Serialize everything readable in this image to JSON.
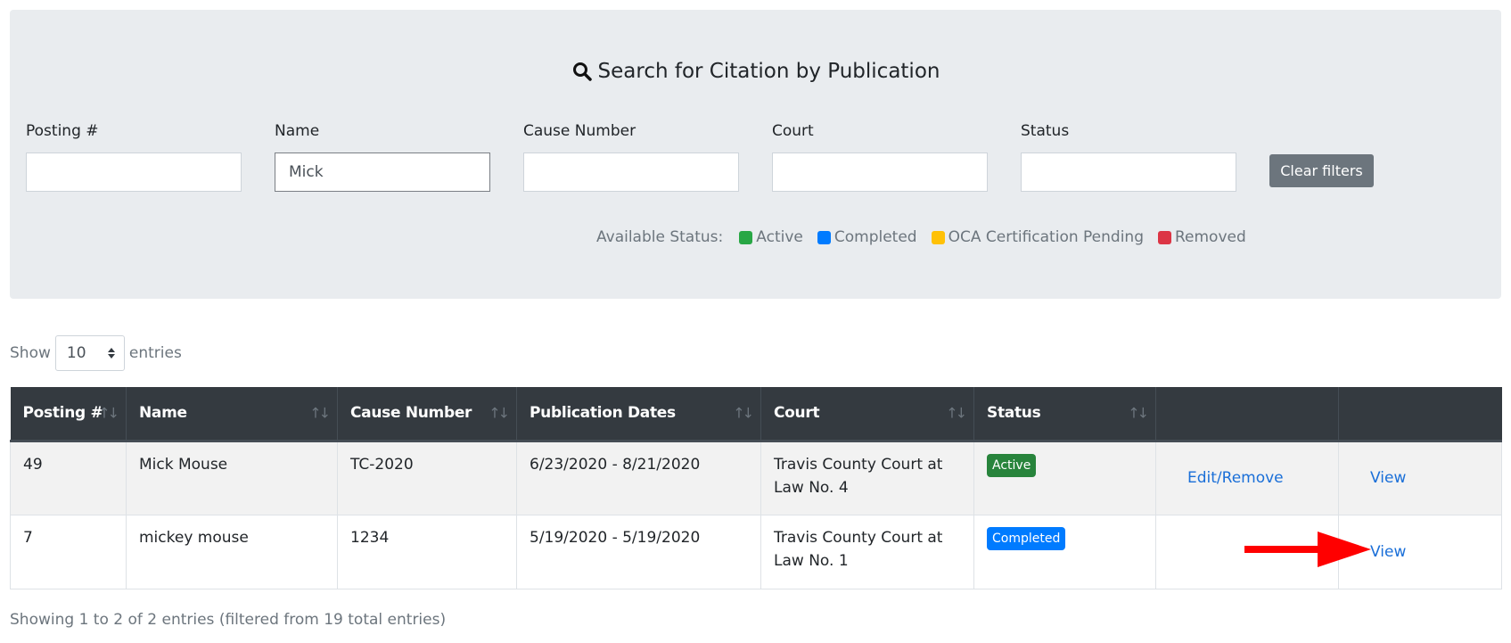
{
  "search_panel": {
    "title": "Search for Citation by Publication",
    "title_icon": "search-icon",
    "filters": [
      {
        "label": "Posting #",
        "value": "",
        "placeholder": ""
      },
      {
        "label": "Name",
        "value": "Mick",
        "placeholder": ""
      },
      {
        "label": "Cause Number",
        "value": "",
        "placeholder": ""
      },
      {
        "label": "Court",
        "value": "",
        "placeholder": ""
      },
      {
        "label": "Status",
        "value": "",
        "placeholder": ""
      }
    ],
    "clear_button": "Clear filters",
    "legend": {
      "label": "Available Status:",
      "items": [
        {
          "label": "Active",
          "color": "#28a745"
        },
        {
          "label": "Completed",
          "color": "#007bff"
        },
        {
          "label": "OCA Certification Pending",
          "color": "#ffc107"
        },
        {
          "label": "Removed",
          "color": "#dc3545"
        }
      ]
    }
  },
  "length_menu": {
    "show_label": "Show",
    "selected": "10",
    "entries_label": "entries"
  },
  "table": {
    "columns": [
      "Posting #",
      "Name",
      "Cause Number",
      "Publication Dates",
      "Court",
      "Status",
      "",
      ""
    ],
    "sort_icon": "↑↓",
    "rows": [
      {
        "posting": "49",
        "name": "Mick Mouse",
        "cause_number": "TC-2020",
        "publication_dates": "6/23/2020 - 8/21/2020",
        "court": "Travis County Court at Law No. 4",
        "status": "Active",
        "status_color": "#28843c",
        "edit_label": "Edit/Remove",
        "view_label": "View"
      },
      {
        "posting": "7",
        "name": "mickey mouse",
        "cause_number": "1234",
        "publication_dates": "5/19/2020 - 5/19/2020",
        "court": "Travis County Court at Law No. 1",
        "status": "Completed",
        "status_color": "#007bff",
        "edit_label": "",
        "view_label": "View"
      }
    ]
  },
  "info": "Showing 1 to 2 of 2 entries (filtered from 19 total entries)",
  "annotation": {
    "arrow_color": "#ff0000",
    "arrow_target": "View"
  }
}
